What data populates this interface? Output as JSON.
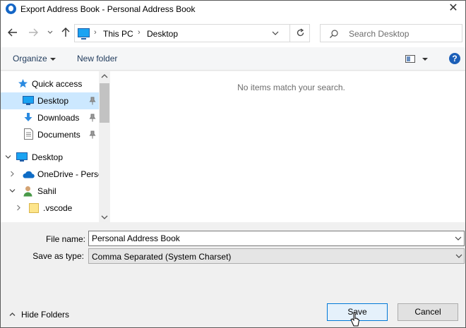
{
  "window": {
    "title": "Export Address Book - Personal Address Book",
    "close_glyph": "✕"
  },
  "navigation": {
    "breadcrumb": [
      "This PC",
      "Desktop"
    ],
    "separator": "›",
    "search_placeholder": "Search Desktop"
  },
  "toolbar": {
    "organize_label": "Organize",
    "new_folder_label": "New folder",
    "help_glyph": "?"
  },
  "nav_pane": {
    "items": [
      {
        "label": "Quick access",
        "icon": "star-icon"
      },
      {
        "label": "Desktop",
        "icon": "desktop-icon",
        "selected": true,
        "pinned": true
      },
      {
        "label": "Downloads",
        "icon": "download-icon",
        "pinned": true
      },
      {
        "label": "Documents",
        "icon": "documents-icon",
        "pinned": true
      },
      {
        "label": "Desktop",
        "icon": "desktop-icon"
      },
      {
        "label": "OneDrive - Persc",
        "icon": "cloud-icon"
      },
      {
        "label": "Sahil",
        "icon": "user-icon"
      },
      {
        "label": ".vscode",
        "icon": "folder-icon"
      }
    ]
  },
  "content": {
    "empty_message": "No items match your search."
  },
  "form": {
    "file_name_label": "File name:",
    "file_name_value": "Personal Address Book",
    "save_type_label": "Save as type:",
    "save_type_value": "Comma Separated (System Charset)"
  },
  "footer": {
    "hide_folders_label": "Hide Folders",
    "save_label": "Save",
    "cancel_label": "Cancel"
  }
}
